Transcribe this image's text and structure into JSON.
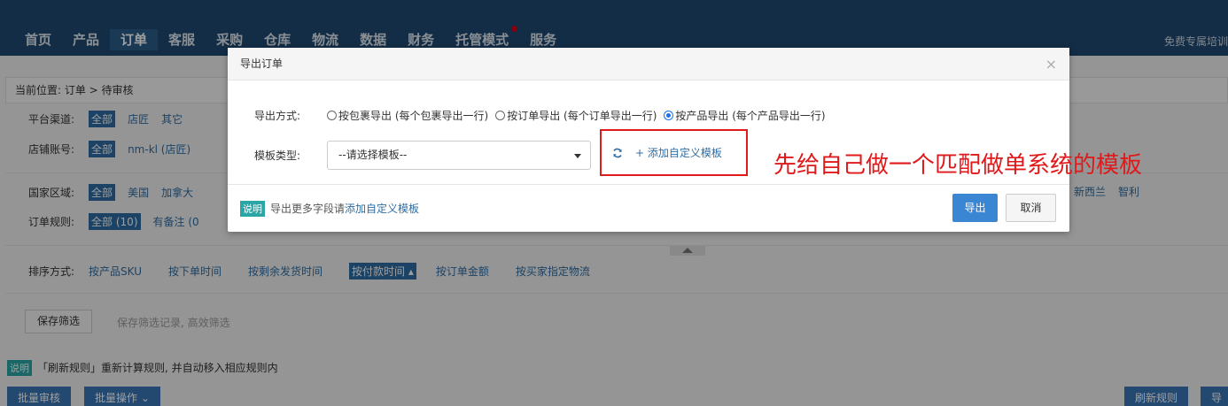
{
  "nav": {
    "items": [
      "首页",
      "产品",
      "订单",
      "客服",
      "采购",
      "仓库",
      "物流",
      "数据",
      "财务",
      "托管模式",
      "服务"
    ],
    "active": "订单",
    "right_link": "免费专属培训"
  },
  "background": {
    "breadcrumb": "当前位置:  订单 > 待审核",
    "platform": {
      "label": "平台渠道:",
      "options": [
        "全部",
        "店匠",
        "其它"
      ]
    },
    "store": {
      "label": "店铺账号:",
      "options": [
        "全部",
        "nm-kl (店匠)"
      ]
    },
    "country": {
      "label": "国家区域:",
      "options": [
        "全部",
        "美国",
        "加拿大"
      ],
      "right_options": [
        "新西兰",
        "智利"
      ]
    },
    "order_rule": {
      "label": "订单规则:",
      "options": [
        "全部 (10)",
        "有备注 (0"
      ]
    },
    "sort": {
      "label": "排序方式:",
      "options": [
        "按产品SKU",
        "按下单时间",
        "按剩余发货时间",
        "按付款时间 ▴",
        "按订单金额",
        "按买家指定物流"
      ]
    },
    "save_filter": "保存筛选",
    "save_hint": "保存筛选记录, 高效筛选",
    "note_badge": "说明",
    "refresh_note": "「刷新规则」重新计算规则, 并自动移入相应规则内",
    "buttons": [
      "批量审核",
      "批量操作 ⌄",
      "刷新规则",
      "导"
    ]
  },
  "modal": {
    "title": "导出订单",
    "close": "×",
    "export_mode_label": "导出方式:",
    "export_modes": [
      "按包裹导出 (每个包裹导出一行)",
      "按订单导出 (每个订单导出一行)",
      "按产品导出 (每个产品导出一行)"
    ],
    "checked_mode_index": 2,
    "template_label": "模板类型:",
    "template_placeholder": "--请选择模板--",
    "add_template": "+ 添加自定义模板",
    "footer_badge": "说明",
    "footer_text": "导出更多字段请",
    "footer_link": "添加自定义模板",
    "export_button": "导出",
    "cancel_button": "取消"
  },
  "annotation": "先给自己做一个匹配做单系统的模板",
  "colors": {
    "nav_bg": "#1f4a71",
    "accent": "#3b86d2",
    "annotation": "#e0191b"
  }
}
